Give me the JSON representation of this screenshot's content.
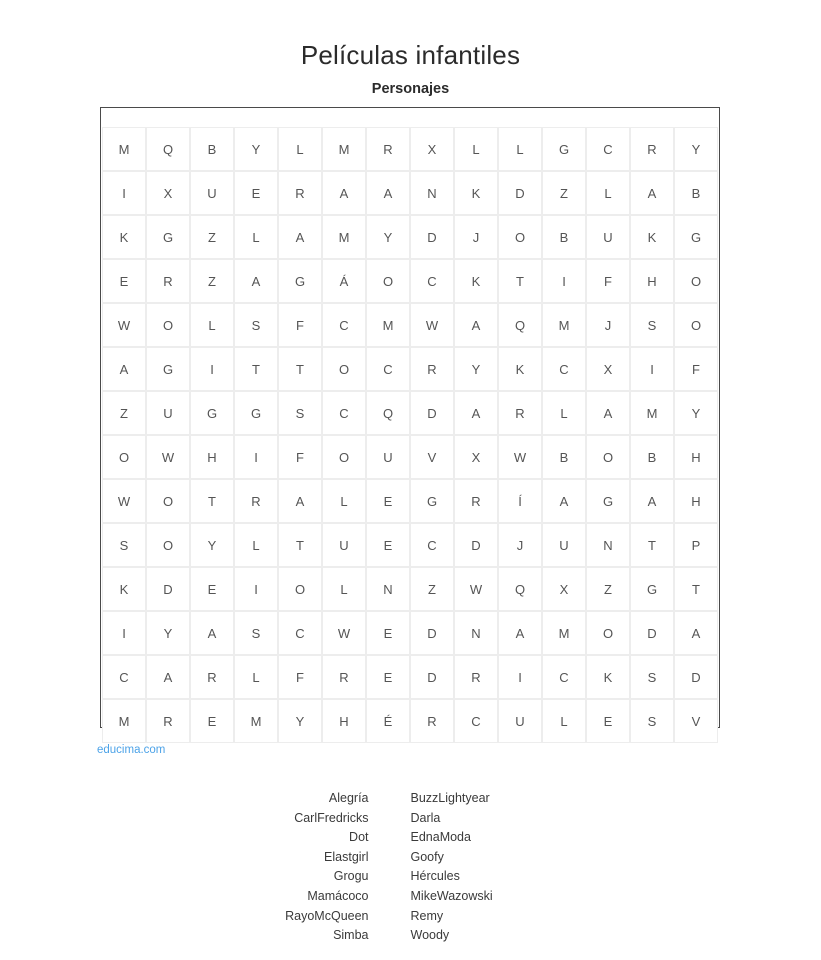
{
  "header": {
    "title": "Películas infantiles",
    "subtitle": "Personajes"
  },
  "source": {
    "link_label": "educima.com",
    "link_color": "#4da3e8"
  },
  "grid": {
    "rows": 14,
    "cols": 14,
    "letters": [
      [
        "M",
        "Q",
        "B",
        "Y",
        "L",
        "M",
        "R",
        "X",
        "L",
        "L",
        "G",
        "C",
        "R",
        "Y"
      ],
      [
        "I",
        "X",
        "U",
        "E",
        "R",
        "A",
        "A",
        "N",
        "K",
        "D",
        "Z",
        "L",
        "A",
        "B"
      ],
      [
        "K",
        "G",
        "Z",
        "L",
        "A",
        "M",
        "Y",
        "D",
        "J",
        "O",
        "B",
        "U",
        "K",
        "G"
      ],
      [
        "E",
        "R",
        "Z",
        "A",
        "G",
        "Á",
        "O",
        "C",
        "K",
        "T",
        "I",
        "F",
        "H",
        "O"
      ],
      [
        "W",
        "O",
        "L",
        "S",
        "F",
        "C",
        "M",
        "W",
        "A",
        "Q",
        "M",
        "J",
        "S",
        "O"
      ],
      [
        "A",
        "G",
        "I",
        "T",
        "T",
        "O",
        "C",
        "R",
        "Y",
        "K",
        "C",
        "X",
        "I",
        "F"
      ],
      [
        "Z",
        "U",
        "G",
        "G",
        "S",
        "C",
        "Q",
        "D",
        "A",
        "R",
        "L",
        "A",
        "M",
        "Y"
      ],
      [
        "O",
        "W",
        "H",
        "I",
        "F",
        "O",
        "U",
        "V",
        "X",
        "W",
        "B",
        "O",
        "B",
        "H"
      ],
      [
        "W",
        "O",
        "T",
        "R",
        "A",
        "L",
        "E",
        "G",
        "R",
        "Í",
        "A",
        "G",
        "A",
        "H"
      ],
      [
        "S",
        "O",
        "Y",
        "L",
        "T",
        "U",
        "E",
        "C",
        "D",
        "J",
        "U",
        "N",
        "T",
        "P"
      ],
      [
        "K",
        "D",
        "E",
        "I",
        "O",
        "L",
        "N",
        "Z",
        "W",
        "Q",
        "X",
        "Z",
        "G",
        "T"
      ],
      [
        "I",
        "Y",
        "A",
        "S",
        "C",
        "W",
        "E",
        "D",
        "N",
        "A",
        "M",
        "O",
        "D",
        "A"
      ],
      [
        "C",
        "A",
        "R",
        "L",
        "F",
        "R",
        "E",
        "D",
        "R",
        "I",
        "C",
        "K",
        "S",
        "D"
      ],
      [
        "M",
        "R",
        "E",
        "M",
        "Y",
        "H",
        "É",
        "R",
        "C",
        "U",
        "L",
        "E",
        "S",
        "V"
      ]
    ]
  },
  "words": {
    "column_left": [
      "Alegría",
      "CarlFredricks",
      "Dot",
      "Elastgirl",
      "Grogu",
      "Mamácoco",
      "RayoMcQueen",
      "Simba"
    ],
    "column_right": [
      "BuzzLightyear",
      "Darla",
      "EdnaModa",
      "Goofy",
      "Hércules",
      "MikeWazowski",
      "Remy",
      "Woody"
    ]
  }
}
